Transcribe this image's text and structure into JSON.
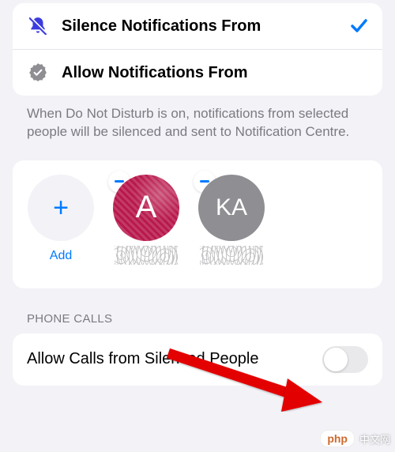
{
  "options": {
    "silence": {
      "label": "Silence Notifications From",
      "icon_color": "#3b3be0",
      "selected": true
    },
    "allow": {
      "label": "Allow Notifications From",
      "icon_color": "#8e8e93",
      "selected": false
    }
  },
  "description": "When Do Not Disturb is on, notifications from selected people will be silenced and sent to Notification Centre.",
  "add": {
    "label": "Add",
    "plus": "+"
  },
  "avatars": [
    {
      "initials": "A"
    },
    {
      "initials": "KA"
    }
  ],
  "section_header": "PHONE CALLS",
  "switch": {
    "label": "Allow Calls from Silenced People"
  },
  "watermark": {
    "badge": "php",
    "text": "中文网"
  }
}
